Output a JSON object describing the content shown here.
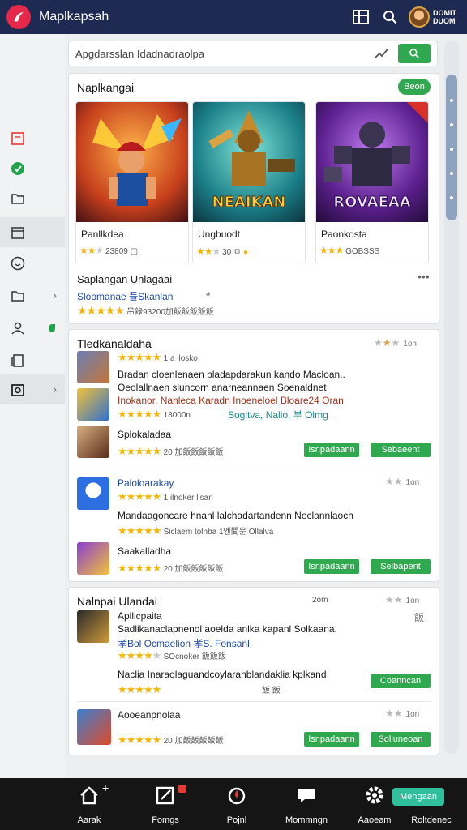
{
  "header": {
    "title": "Maplkapsah",
    "user_name": "DOMIT DUOM"
  },
  "search": {
    "placeholder": "Apgdarsslan Idadnadraolpa"
  },
  "featured": {
    "title": "Naplkangai",
    "button": "Beon",
    "games": [
      {
        "name": "Panllkdea",
        "meta": "23809",
        "rating": 2,
        "art_text": "",
        "icon": "hero-fire-art"
      },
      {
        "name": "Ungbuodt",
        "meta": "30 ㅁ",
        "rating": 2,
        "art_text": "NEAIKAN",
        "icon": "warrior-gold-art"
      },
      {
        "name": "Paonkosta",
        "meta": "GOBSSS",
        "rating": 3,
        "art_text": "ROVAEAA",
        "icon": "knight-purple-art"
      }
    ],
    "sub_title": "Saplangan Unlagaai",
    "sub_line": "Sloomanae 플Skanlan",
    "sub_meta": "吊錄93200加飯飯飯飯飯",
    "more_label": "•••"
  },
  "list1": {
    "title": "Tledkanaldaha",
    "rating_text": "1on",
    "item1_meta": "1 a ilosko",
    "desc1": "Bradan cloenlenaen bladapdarakun kando Macloan..",
    "desc2": "Oeolallnaen sluncorn anarneannaen Soenaldnet",
    "desc3": "Inokanor, Nanleca  Karadn Inoeneloel Bloare24 Oran",
    "item2_meta": "18000n",
    "item2_tags": "Sogitva,  Nalio,  부 Olmg",
    "item3_name": "Splokaladaa",
    "item3_meta": "20 加飯飯飯飯飯",
    "btn_a": "Isnpadaann",
    "btn_b": "Sebaeent",
    "item4_name": "Paloloarakay",
    "item4_meta": "1 ilnoker  lisan",
    "item4_desc": "Mandaagoncare hnanl lalchadartandenn Neclannlaoch",
    "item4_tags": "Siclaem  tolnba  1엔間문 Ollalva",
    "item5_name": "Saakalladha",
    "item5_meta": "20 加飯飯飯飯飯",
    "btn_c": "Isnpadaann",
    "btn_d": "Selbapent",
    "rating_text_2": "1on"
  },
  "list2": {
    "title": "Nalnpai Ulandai",
    "right_meta": "2om",
    "rating_text": "1on",
    "item1_name": "Apllicpaita",
    "item1_desc": "Sadlikanaclapnenol aoelda anlka kapanl Solkaana.",
    "item1_tags": "孝Bol  Ocmaelion  孝S. Fonsanl",
    "item1_meta": "SOcnoker 飯飯飯",
    "item1_side": "飯",
    "item2_desc": "Naclia Inaraolaguandcoylaranblandaklia kplkand",
    "item2_meta": "飯 飯",
    "btn_a": "Coanncan",
    "item3_name": "Aooeanpnolaa",
    "item3_meta": "20 加飯飯飯飯飯",
    "rating_text_2": "1on",
    "btn_b": "Isnpadaann",
    "btn_c": "Solluneoan"
  },
  "bottom_nav": {
    "items": [
      "Aarak",
      "Fomgs",
      "Pojnl",
      "Mommngn",
      "Aaoeam",
      "Roltdenec"
    ],
    "cta": "Mengaan"
  },
  "colors": {
    "header_bg": "#1f2a52",
    "accent_green": "#2fa84f",
    "star": "#f4b400",
    "nav_bg": "#151515"
  }
}
